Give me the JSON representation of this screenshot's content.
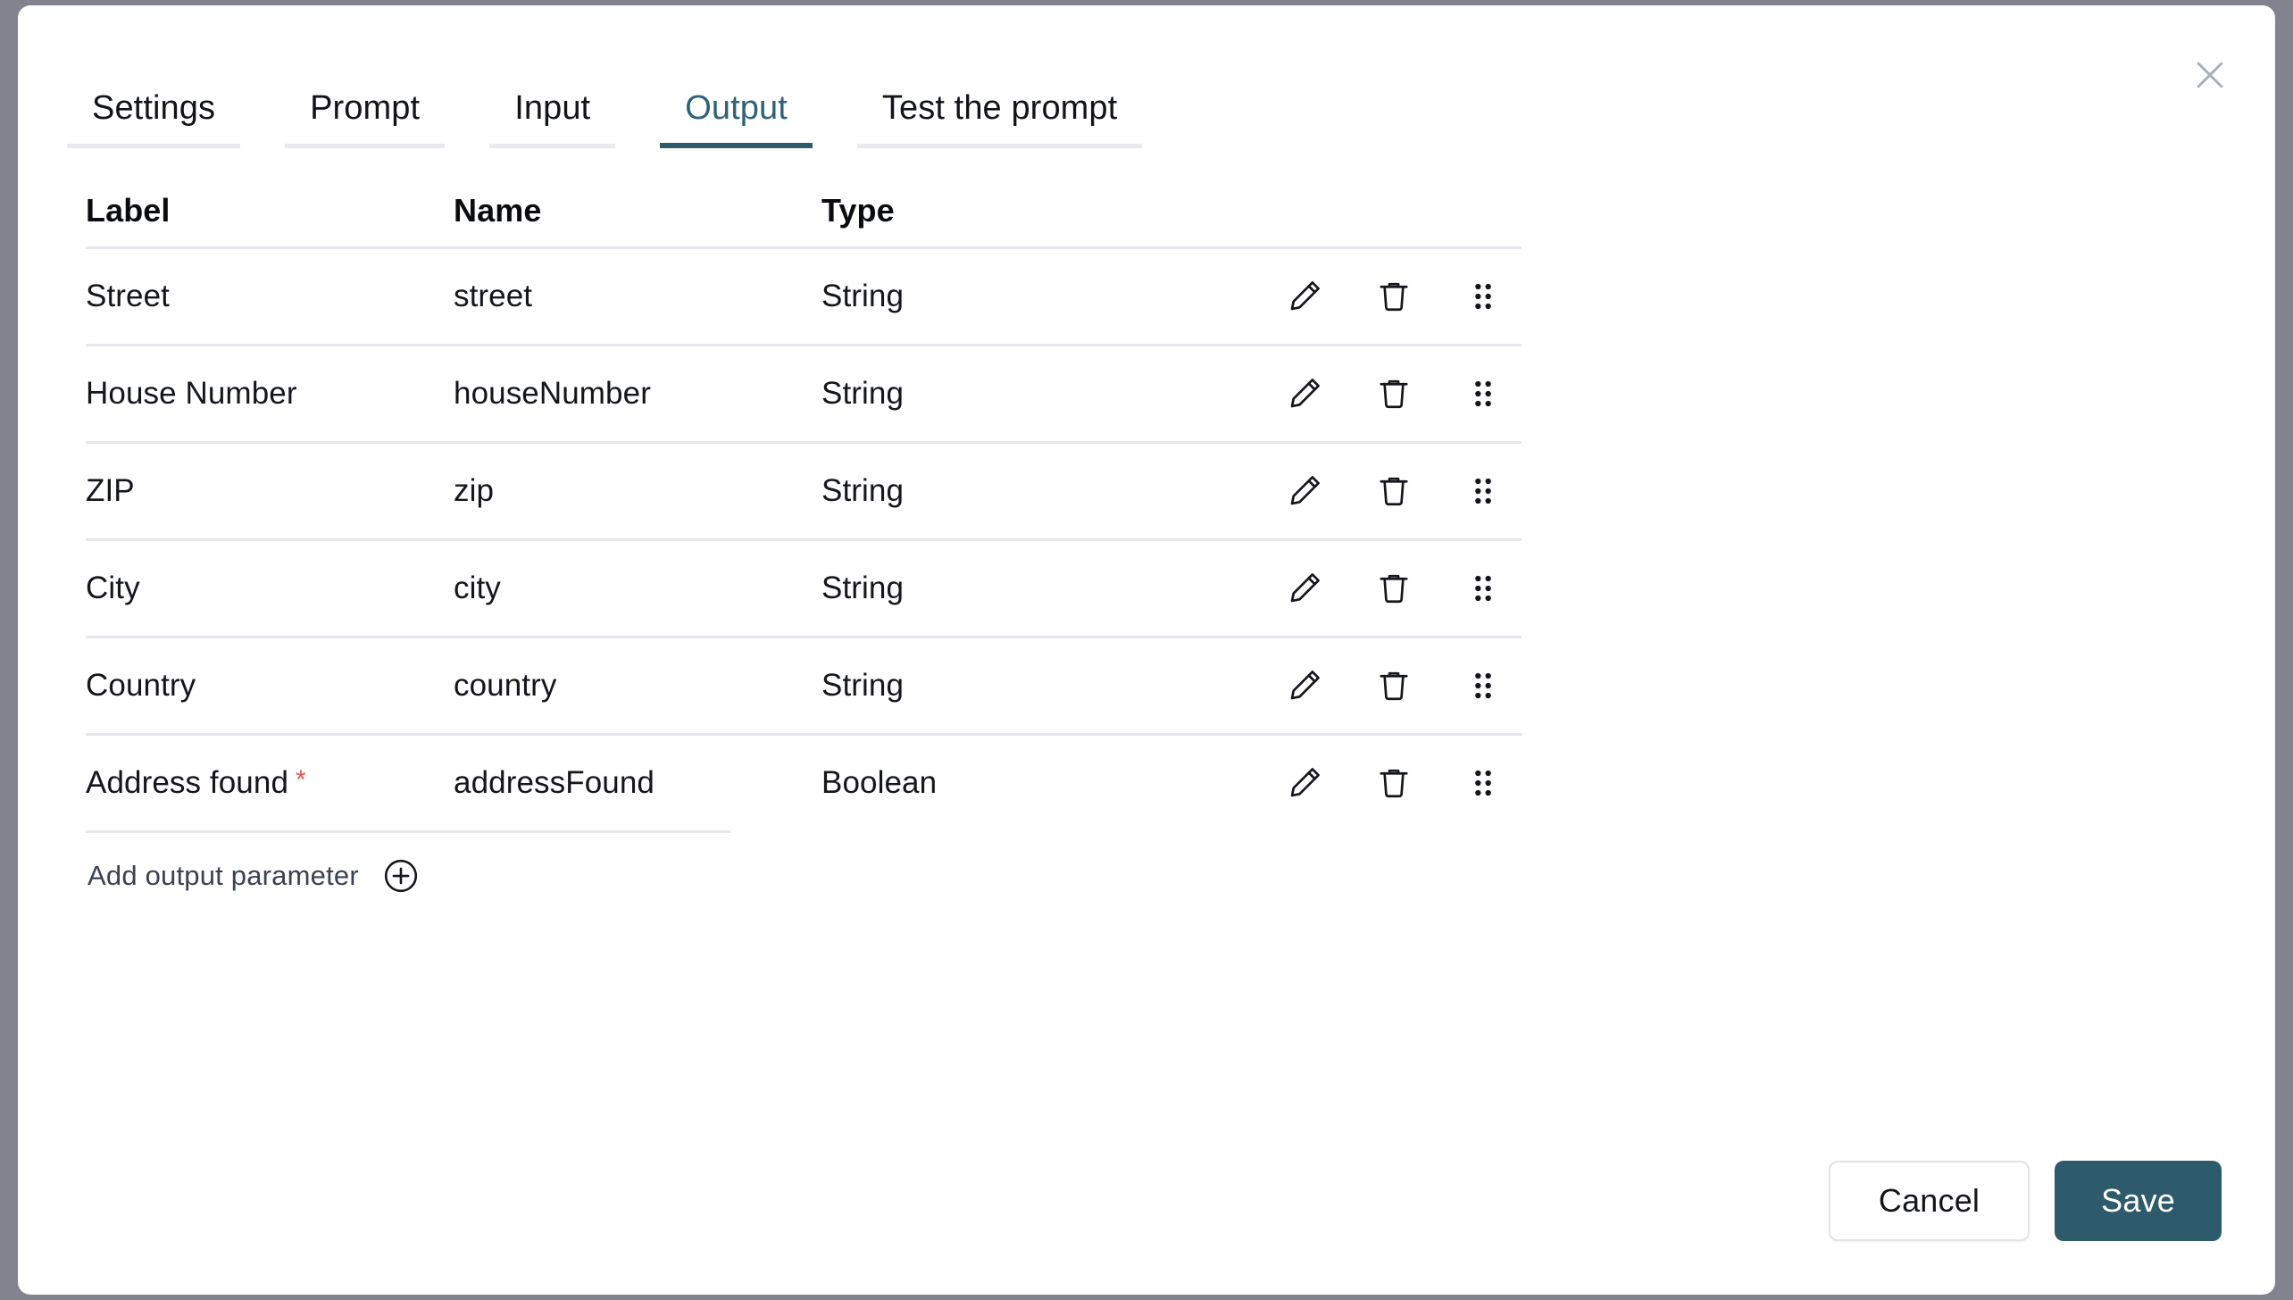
{
  "dialog": {
    "close_icon": "close-icon"
  },
  "tabs": [
    {
      "label": "Settings",
      "active": false
    },
    {
      "label": "Prompt",
      "active": false
    },
    {
      "label": "Input",
      "active": false
    },
    {
      "label": "Output",
      "active": true
    },
    {
      "label": "Test the prompt",
      "active": false
    }
  ],
  "table": {
    "headers": {
      "label": "Label",
      "name": "Name",
      "type": "Type"
    },
    "rows": [
      {
        "label": "Street",
        "name": "street",
        "type": "String",
        "required": false
      },
      {
        "label": "House Number",
        "name": "houseNumber",
        "type": "String",
        "required": false
      },
      {
        "label": "ZIP",
        "name": "zip",
        "type": "String",
        "required": false
      },
      {
        "label": "City",
        "name": "city",
        "type": "String",
        "required": false
      },
      {
        "label": "Country",
        "name": "country",
        "type": "String",
        "required": false
      },
      {
        "label": "Address found",
        "name": "addressFound",
        "type": "Boolean",
        "required": true
      }
    ],
    "required_marker": "*",
    "row_actions": {
      "edit_icon": "pencil-icon",
      "delete_icon": "trash-icon",
      "drag_icon": "drag-handle-icon"
    }
  },
  "add_parameter": {
    "label": "Add output parameter",
    "icon": "plus-circle-icon"
  },
  "footer": {
    "cancel_label": "Cancel",
    "save_label": "Save"
  },
  "colors": {
    "accent": "#2e5b6b",
    "active_tab_text": "#2e6277",
    "required_star": "#e2584d",
    "divider": "#e7e7ed",
    "overlay": "#82838f",
    "surface": "#ffffff"
  }
}
